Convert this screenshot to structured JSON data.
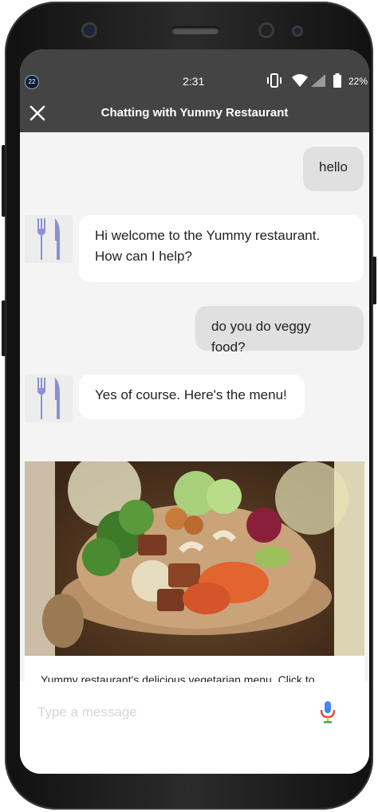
{
  "status_bar": {
    "time": "2:31",
    "notification_badge": "22",
    "battery_percent": "22%",
    "icons": [
      "vibrate-icon",
      "wifi-icon",
      "cell-signal-icon",
      "battery-icon"
    ]
  },
  "header": {
    "title": "Chatting with Yummy Restaurant",
    "close_icon": "close-icon"
  },
  "messages": [
    {
      "sender": "user",
      "text": "hello"
    },
    {
      "sender": "bot",
      "text": "Hi welcome to the Yummy restaurant. How can I help?"
    },
    {
      "sender": "user",
      "text": "do you do veggy food?"
    },
    {
      "sender": "bot",
      "text": "Yes of course. Here's the menu!"
    }
  ],
  "bot_avatar_icon": "fork-knife-icon",
  "card": {
    "image_alt": "vegetarian bowl",
    "caption": "Yummy restaurant's delicious vegetarian menu. Click to"
  },
  "composer": {
    "placeholder": "Type a message",
    "value": "",
    "mic_icon": "microphone-icon"
  },
  "colors": {
    "header_bg": "#444444",
    "chat_bg": "#f4f4f4",
    "user_bubble": "#e0e0e0",
    "bot_bubble": "#ffffff",
    "avatar_icon": "#8a8fd6",
    "mic_blue": "#4285f4",
    "mic_red": "#ea4335"
  }
}
